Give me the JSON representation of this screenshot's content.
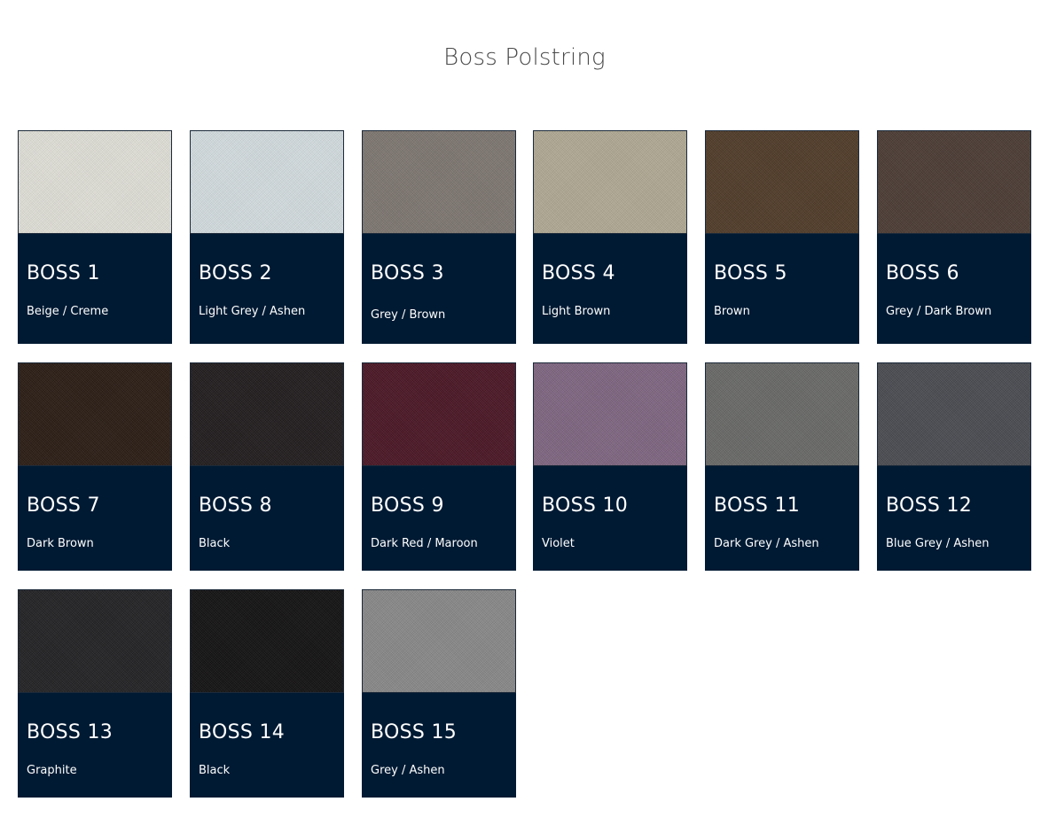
{
  "page": {
    "title": "Boss Polstring"
  },
  "swatches": [
    {
      "code": "BOSS 1",
      "color_name": "Beige / Creme",
      "swatch_color": "#e3e2da"
    },
    {
      "code": "BOSS 2",
      "color_name": "Light Grey / Ashen",
      "swatch_color": "#d6dfe2"
    },
    {
      "code": "BOSS 3",
      "color_name": "Grey / Brown",
      "swatch_color": "#7f7872"
    },
    {
      "code": "BOSS 4",
      "color_name": "Light Brown",
      "swatch_color": "#b2ab95"
    },
    {
      "code": "BOSS 5",
      "color_name": "Brown",
      "swatch_color": "#513c29"
    },
    {
      "code": "BOSS 6",
      "color_name": "Grey / Dark Brown",
      "swatch_color": "#4c3d35"
    },
    {
      "code": "BOSS 7",
      "color_name": "Dark Brown",
      "swatch_color": "#2a1c14"
    },
    {
      "code": "BOSS 8",
      "color_name": "Black",
      "swatch_color": "#211c1d"
    },
    {
      "code": "BOSS 9",
      "color_name": "Dark Red / Maroon",
      "swatch_color": "#4b1625"
    },
    {
      "code": "BOSS 10",
      "color_name": "Violet",
      "swatch_color": "#806782"
    },
    {
      "code": "BOSS 11",
      "color_name": "Dark Grey / Ashen",
      "swatch_color": "#6a6b69"
    },
    {
      "code": "BOSS 12",
      "color_name": "Blue Grey / Ashen",
      "swatch_color": "#4a4c52"
    },
    {
      "code": "BOSS 13",
      "color_name": "Graphite",
      "swatch_color": "#222224"
    },
    {
      "code": "BOSS 14",
      "color_name": "Black",
      "swatch_color": "#131212"
    },
    {
      "code": "BOSS 15",
      "color_name": "Grey / Ashen",
      "swatch_color": "#8a8a8a"
    }
  ],
  "colors": {
    "card_background": "#001a33",
    "title_text": "#4a4a4a"
  }
}
